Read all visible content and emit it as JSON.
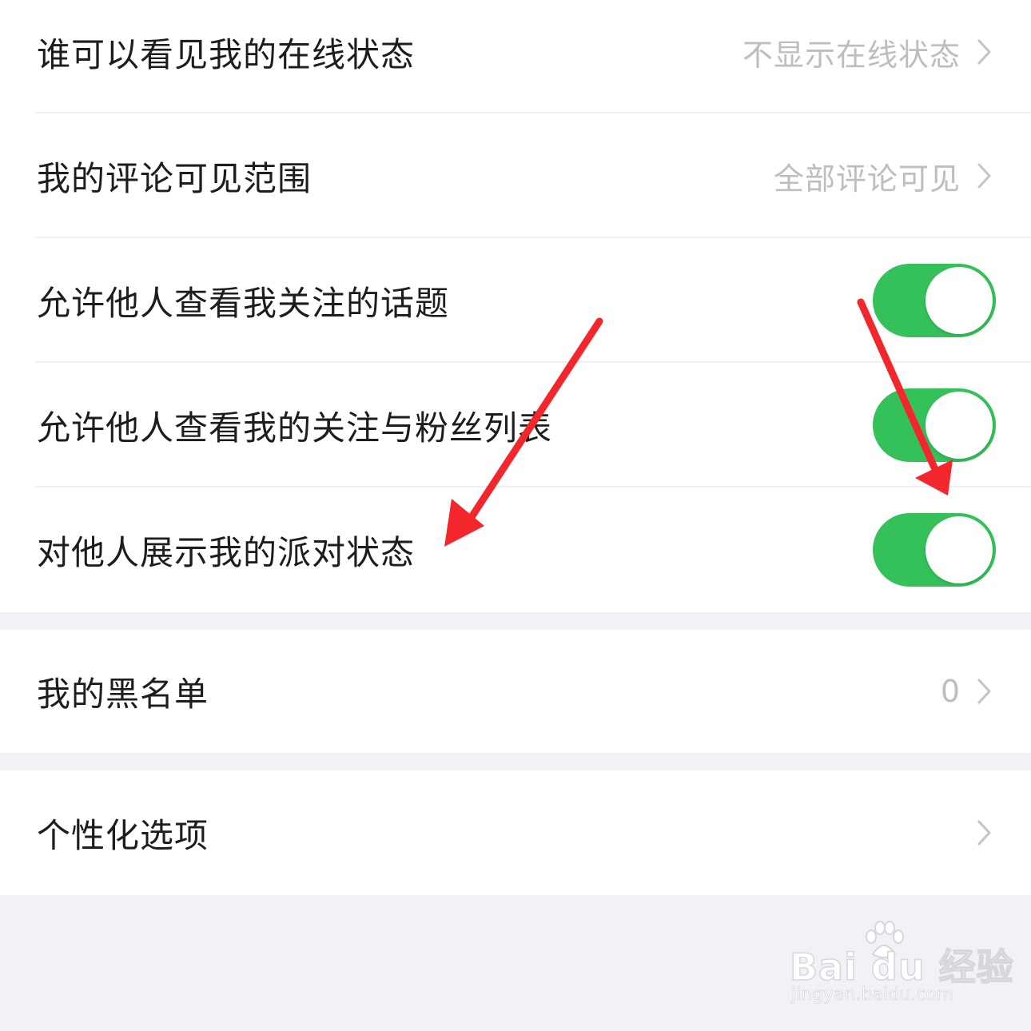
{
  "privacy_group": {
    "rows": [
      {
        "label": "谁可以看见我的在线状态",
        "value": "不显示在线状态"
      },
      {
        "label": "我的评论可见范围",
        "value": "全部评论可见"
      },
      {
        "label": "允许他人查看我关注的话题",
        "toggle_on": true
      },
      {
        "label": "允许他人查看我的关注与粉丝列表",
        "toggle_on": true
      },
      {
        "label": "对他人展示我的派对状态",
        "toggle_on": true
      }
    ]
  },
  "blacklist_group": {
    "label": "我的黑名单",
    "value": "0"
  },
  "personalization_group": {
    "label": "个性化选项"
  },
  "watermark": {
    "brand": "Bai du 经验",
    "url": "jingyan.baidu.com"
  },
  "colors": {
    "toggle_on": "#35c15a",
    "background": "#f2f2f6",
    "annotation_arrow": "#f3262b",
    "secondary_text": "#bdbdc2"
  },
  "icons": {
    "chevron": "chevron-right-icon",
    "annotation": "red-arrow-annotation",
    "watermark": "baidu-paw-logo"
  }
}
